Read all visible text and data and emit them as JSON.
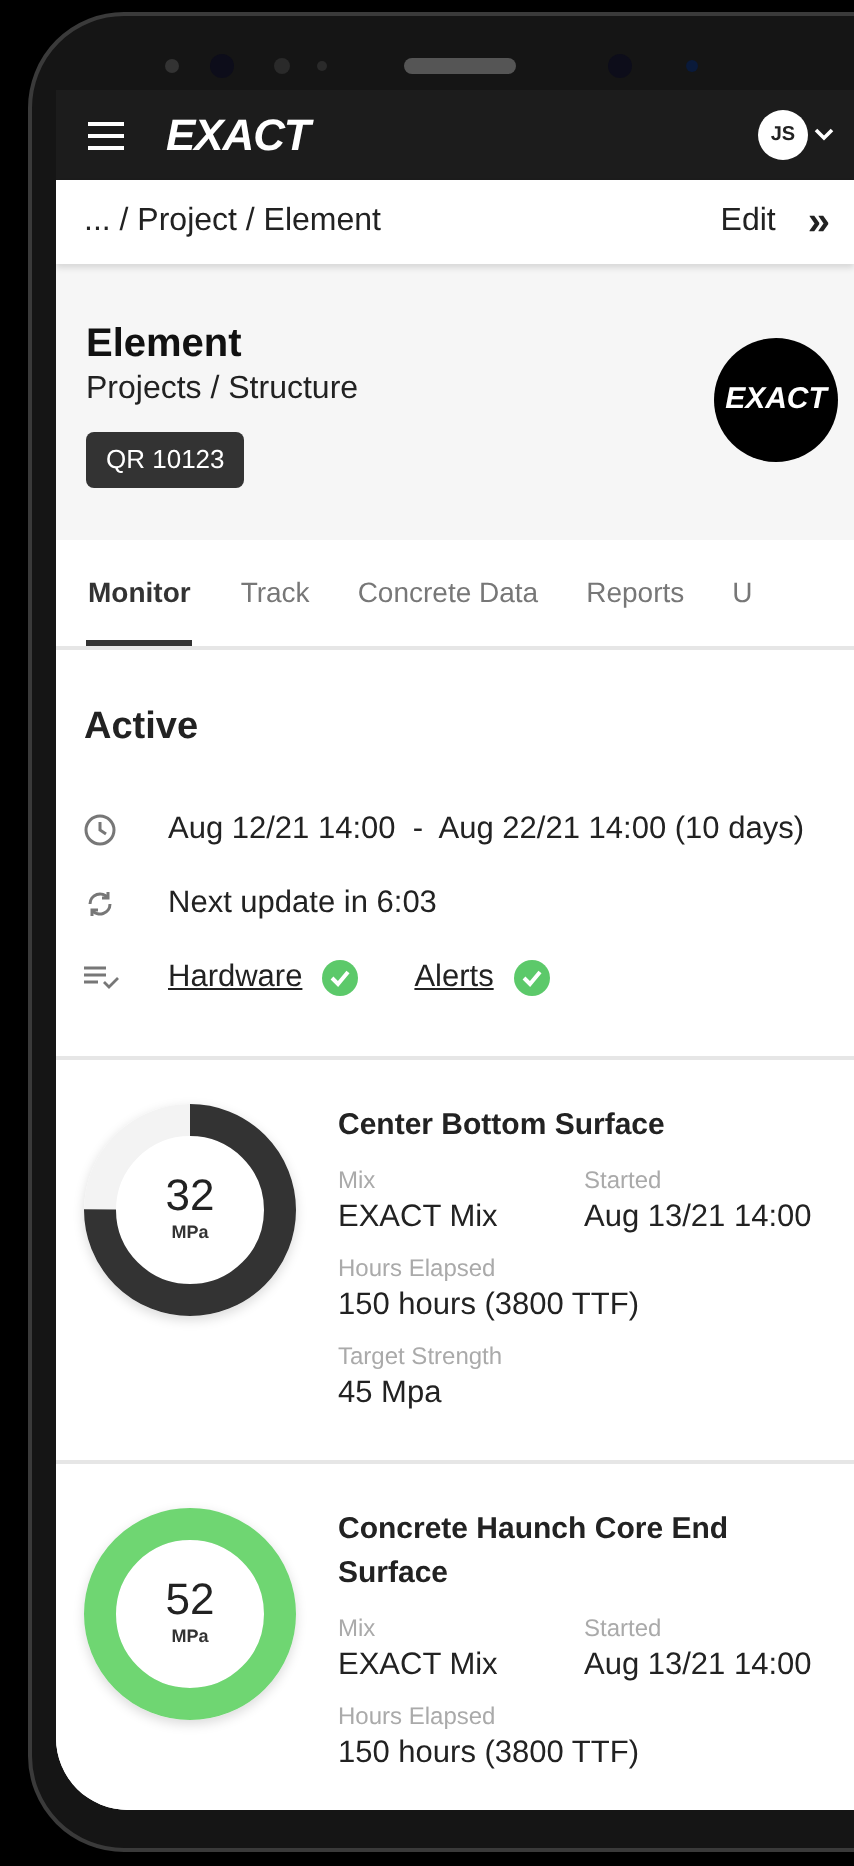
{
  "app_bar": {
    "brand": "EXACT",
    "avatar": "JS"
  },
  "breadcrumb": {
    "path": "... / Project / Element",
    "edit": "Edit",
    "more": "»"
  },
  "header": {
    "title": "Element",
    "subtitle": "Projects / Structure",
    "tag": "QR 10123",
    "logo": "EXACT"
  },
  "tabs": [
    {
      "label": "Monitor",
      "selected": true
    },
    {
      "label": "Track",
      "selected": false
    },
    {
      "label": "Concrete Data",
      "selected": false
    },
    {
      "label": "Reports",
      "selected": false
    },
    {
      "label": "U",
      "selected": false
    }
  ],
  "status": {
    "title": "Active",
    "period": "Aug 12/21 14:00  -  Aug 22/21 14:00 (10 days)",
    "next_update": "Next update in 6:03",
    "checks": [
      {
        "label": "Hardware",
        "ok": true
      },
      {
        "label": "Alerts",
        "ok": true
      }
    ]
  },
  "sensors": [
    {
      "name": "Center Bottom Surface",
      "value": "32",
      "unit": "MPa",
      "level": 0.75,
      "color": "#333333",
      "fields": [
        {
          "label": "Mix",
          "value": "EXACT Mix"
        },
        {
          "label": "Started",
          "value": "Aug 13/21 14:00"
        },
        {
          "label": "Hours Elapsed",
          "value": "150 hours (3800 TTF)"
        },
        {
          "label": "Target Strength",
          "value": "45 Mpa"
        }
      ]
    },
    {
      "name": "Concrete Haunch Core End Surface",
      "value": "52",
      "unit": "MPa",
      "level": 1,
      "color": "#6fd672",
      "fields": [
        {
          "label": "Mix",
          "value": "EXACT Mix"
        },
        {
          "label": "Started",
          "value": "Aug 13/21 14:00"
        },
        {
          "label": "Hours Elapsed",
          "value": "150 hours (3800 TTF)"
        }
      ]
    }
  ]
}
